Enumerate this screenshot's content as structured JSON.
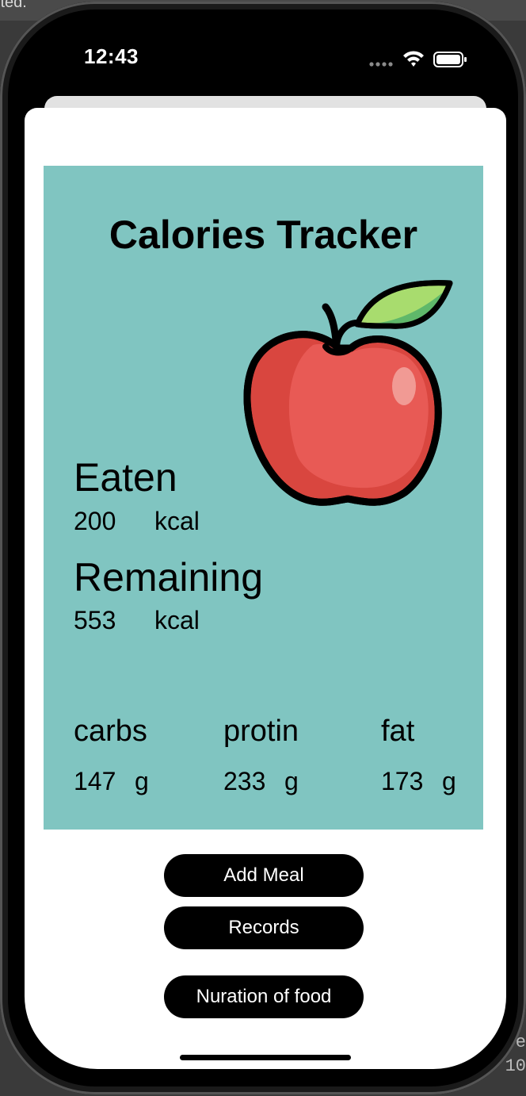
{
  "window": {
    "partial_title": "ited."
  },
  "edge_code": [
    "e",
    "10"
  ],
  "status_bar": {
    "time": "12:43",
    "icons": [
      "signal-dots-icon",
      "wifi-icon",
      "battery-icon"
    ]
  },
  "app": {
    "title": "Calories Tracker",
    "image": "apple-icon",
    "eaten": {
      "label": "Eaten",
      "value": "200",
      "unit": "kcal"
    },
    "remaining": {
      "label": "Remaining",
      "value": "553",
      "unit": "kcal"
    },
    "macros": [
      {
        "label": "carbs",
        "value": "147",
        "unit": "g"
      },
      {
        "label": "protin",
        "value": "233",
        "unit": "g"
      },
      {
        "label": "fat",
        "value": "173",
        "unit": "g"
      }
    ],
    "buttons": {
      "add_meal": "Add Meal",
      "records": "Records",
      "nutrition": "Nuration of food"
    }
  },
  "colors": {
    "panel": "#80c5c1",
    "button": "#000000",
    "apple_red": "#e85a55",
    "leaf_green": "#5fb86a"
  }
}
